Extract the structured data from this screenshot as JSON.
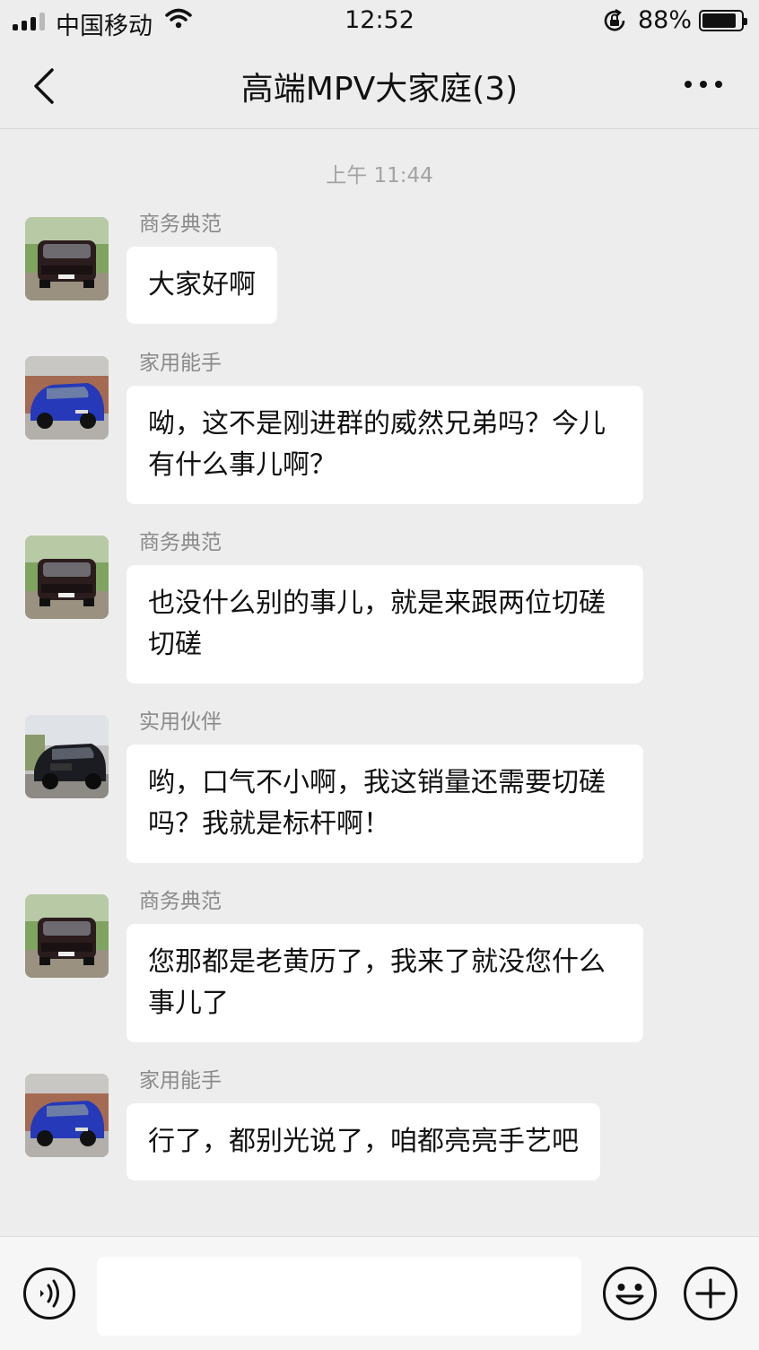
{
  "status_bar": {
    "carrier": "中国移动",
    "time": "12:52",
    "battery_percent": "88%",
    "battery_level": 0.88,
    "signal_bars": 4,
    "signal_bars_filled": 3
  },
  "nav": {
    "title": "高端MPV大家庭(3)",
    "back_icon": "chevron-left-icon",
    "more_icon": "ellipsis-icon"
  },
  "chat": {
    "timestamp": "上午 11:44",
    "messages": [
      {
        "sender": "商务典范",
        "avatar": "car-avatar-dark",
        "text": "大家好啊"
      },
      {
        "sender": "家用能手",
        "avatar": "car-avatar-blue",
        "text": "呦，这不是刚进群的威然兄弟吗？今儿有什么事儿啊？"
      },
      {
        "sender": "商务典范",
        "avatar": "car-avatar-dark",
        "text": "也没什么别的事儿，就是来跟两位切磋切磋"
      },
      {
        "sender": "实用伙伴",
        "avatar": "car-avatar-black",
        "text": "哟，口气不小啊，我这销量还需要切磋吗？我就是标杆啊！"
      },
      {
        "sender": "商务典范",
        "avatar": "car-avatar-dark",
        "text": "您那都是老黄历了，我来了就没您什么事儿了"
      },
      {
        "sender": "家用能手",
        "avatar": "car-avatar-blue",
        "text": "行了，都别光说了，咱都亮亮手艺吧"
      }
    ]
  },
  "input_bar": {
    "text_value": "",
    "icons": [
      "voice-icon",
      "emoji-icon",
      "plus-icon"
    ]
  },
  "colors": {
    "background": "#ededed",
    "bubble": "#ffffff",
    "muted_text": "#8a8a8a"
  }
}
